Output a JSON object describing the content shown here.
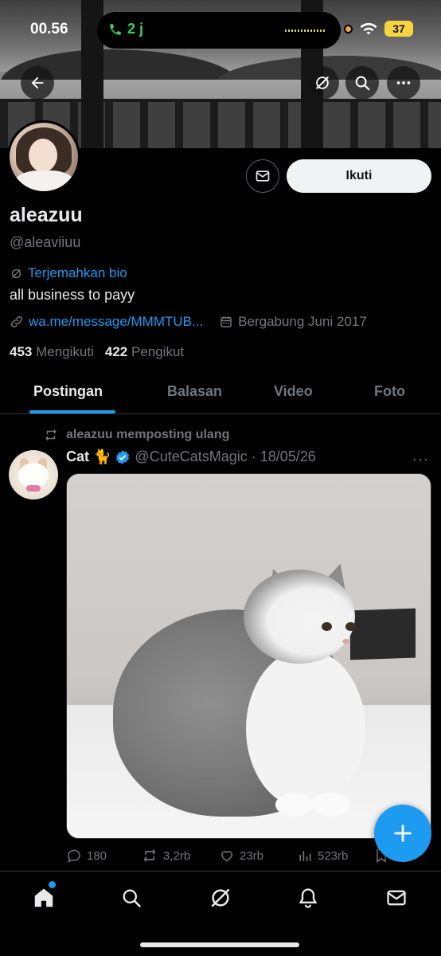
{
  "status_bar": {
    "time": "00.56",
    "call_duration": "2 j",
    "battery": "37",
    "colors": {
      "call": "#35d15a",
      "battery": "#f5d43d"
    }
  },
  "header_actions": {
    "back_icon": "arrow-left-icon",
    "grok_icon": "grok-icon",
    "search_icon": "search-icon",
    "more_icon": "more-horizontal-icon"
  },
  "profile": {
    "follow_label": "Ikuti",
    "name": "aleazuu",
    "handle": "@aleaviiuu",
    "translate_bio": "Terjemahkan bio",
    "bio": "all business to payy",
    "link": "wa.me/message/MMMTUB...",
    "joined": "Bergabung Juni 2017",
    "following_count": "453",
    "following_label": "Mengikuti",
    "followers_count": "422",
    "followers_label": "Pengikut"
  },
  "tabs": [
    {
      "label": "Postingan",
      "active": true
    },
    {
      "label": "Balasan",
      "active": false
    },
    {
      "label": "Video",
      "active": false
    },
    {
      "label": "Foto",
      "active": false
    }
  ],
  "post": {
    "repost_text": "aleazuu memposting ulang",
    "author_name": "Cat 🐈",
    "verified": true,
    "author_handle": "@CuteCatsMagic",
    "separator": "·",
    "date": "18/05/26",
    "more": "···",
    "replies": "180",
    "reposts": "3,2rb",
    "likes": "23rb",
    "views": "523rb"
  },
  "bottom_nav": [
    {
      "icon": "home-icon",
      "active": true,
      "has_badge": true
    },
    {
      "icon": "search-icon"
    },
    {
      "icon": "grok-icon"
    },
    {
      "icon": "bell-icon"
    },
    {
      "icon": "mail-icon"
    }
  ],
  "accent_color": "#1d9bf0"
}
